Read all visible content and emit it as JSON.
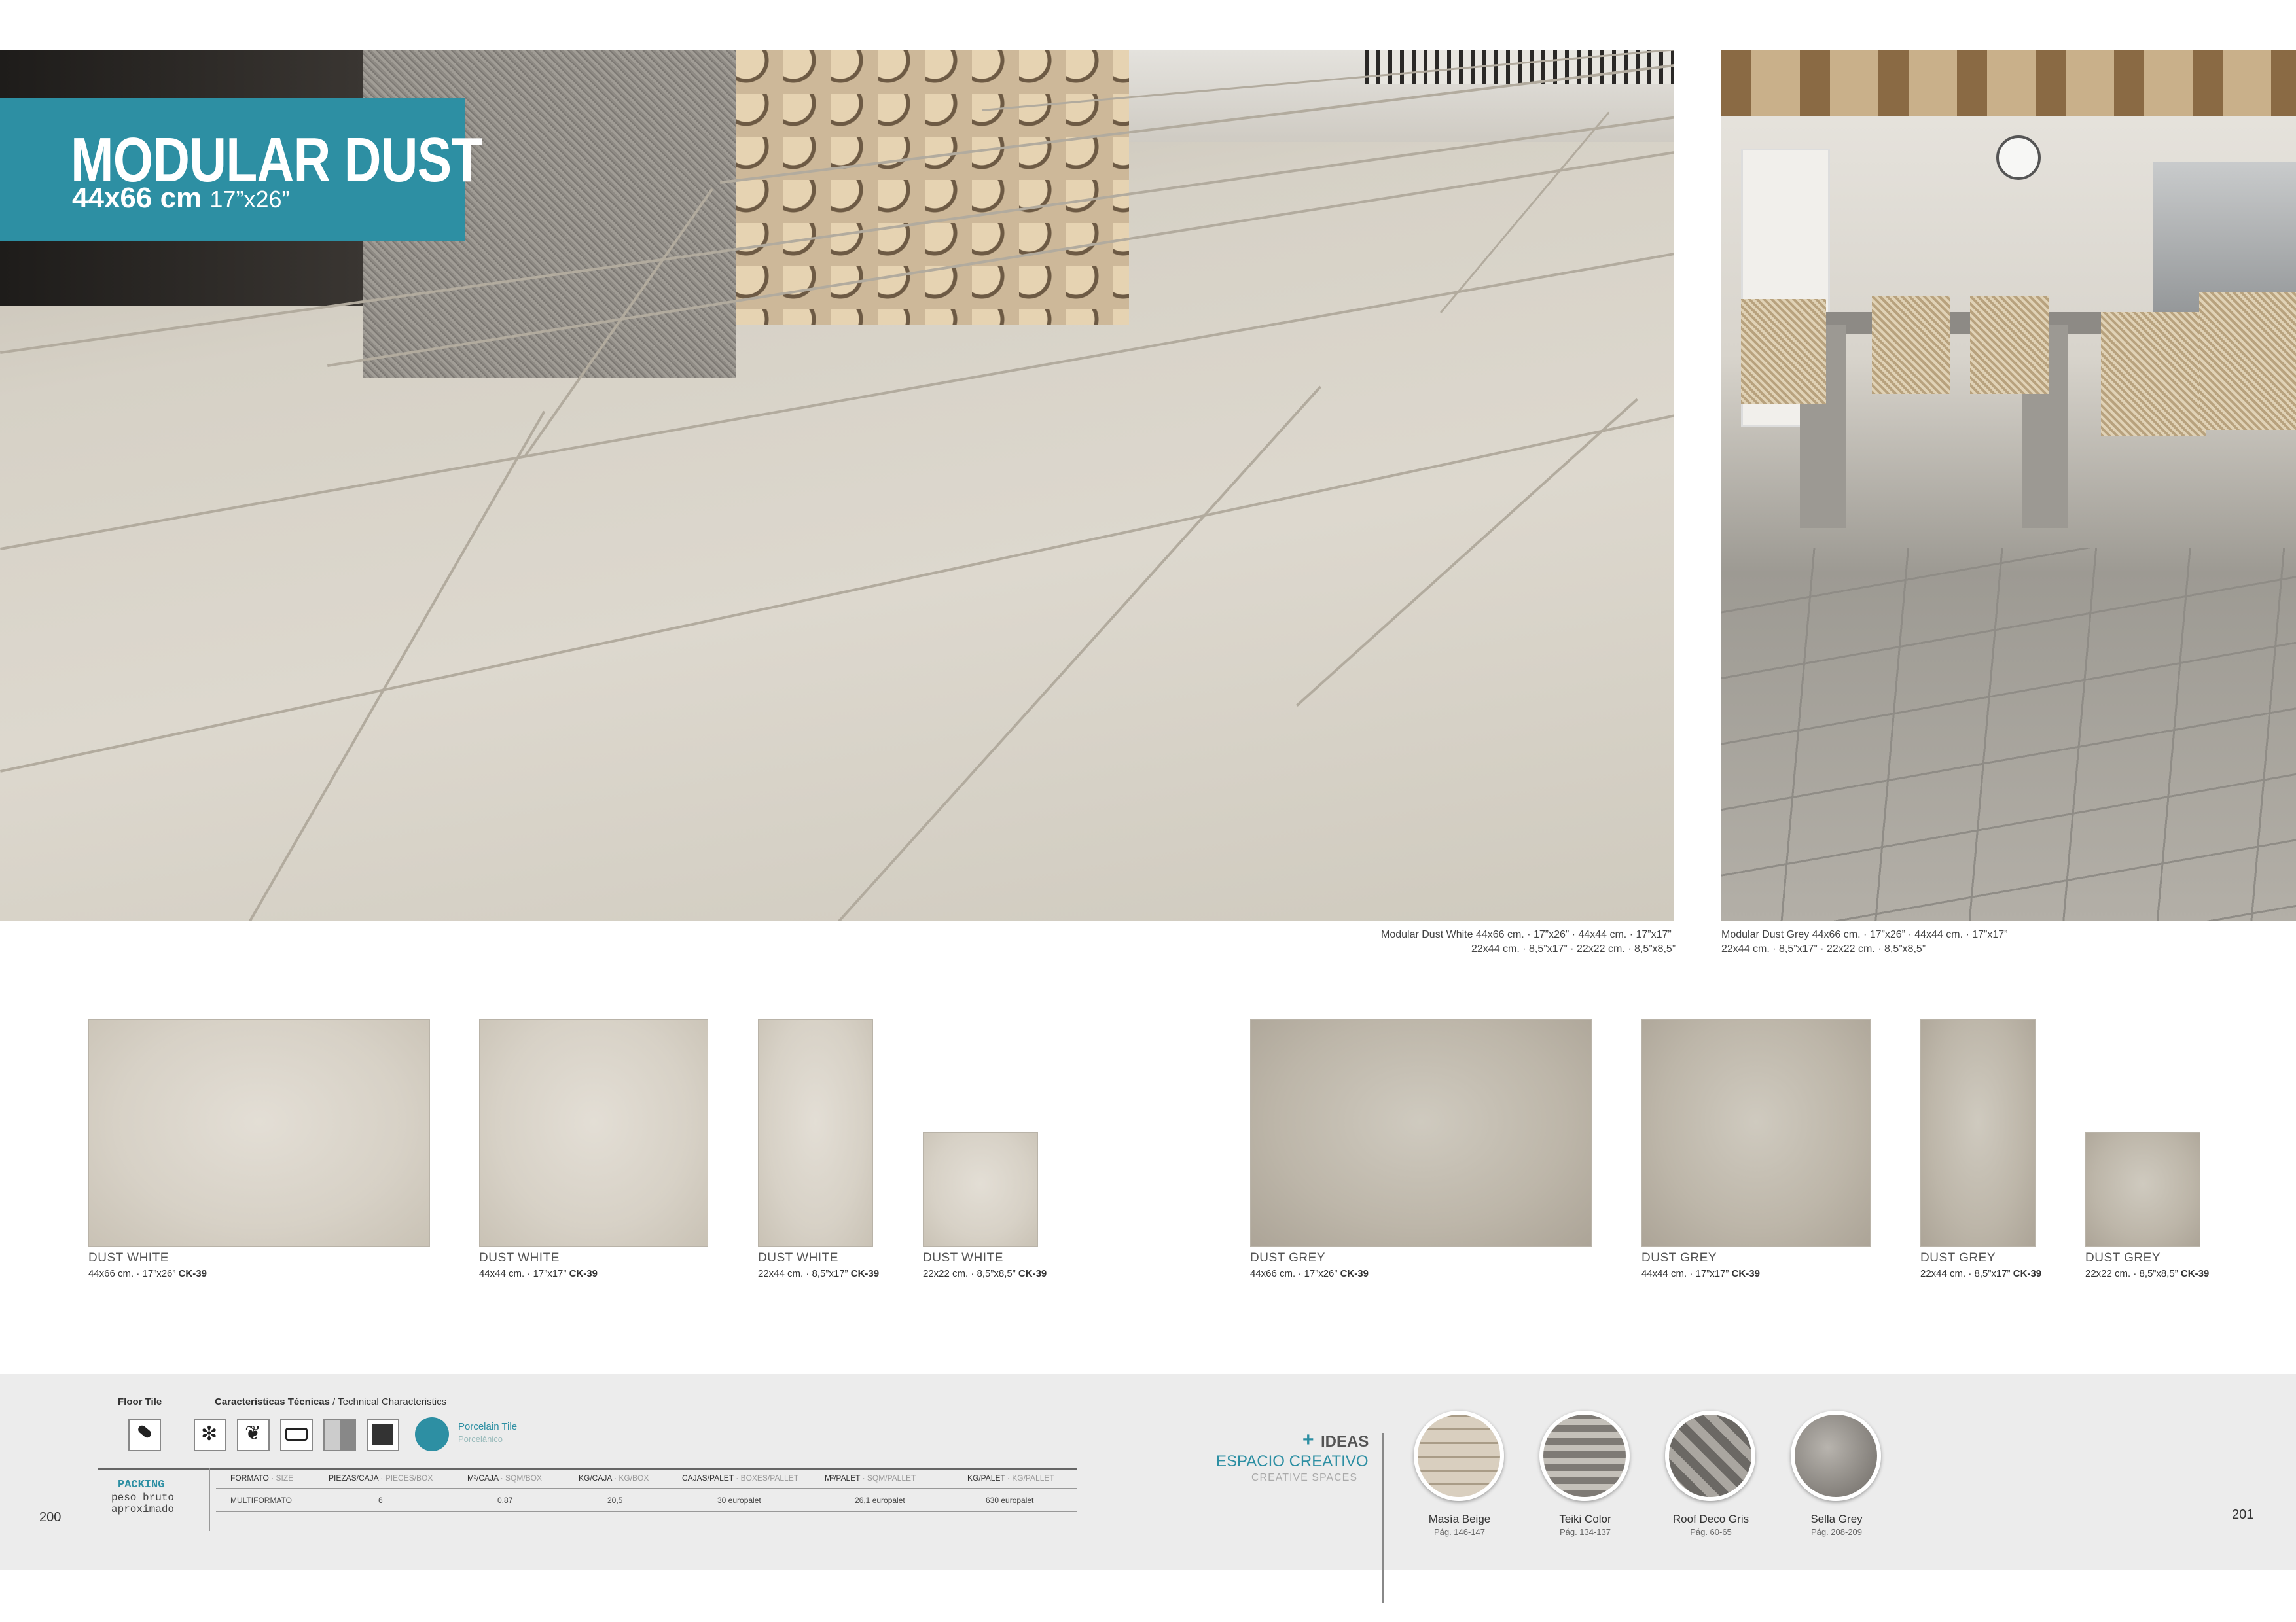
{
  "title": {
    "name": "MODULAR DUST",
    "size_cm": "44x66 cm",
    "size_in": "17”x26”"
  },
  "photos": {
    "main_caption_line1": "Modular Dust White  44x66 cm. · 17”x26” · 44x44 cm. · 17”x17”",
    "main_caption_line2": "22x44 cm. · 8,5”x17” · 22x22 cm. · 8,5”x8,5”",
    "side_caption_line1": "Modular Dust Grey  44x66 cm. · 17”x26” · 44x44 cm. · 17”x17”",
    "side_caption_line2": "22x44 cm. · 8,5”x17” · 22x22 cm. · 8,5”x8,5”"
  },
  "swatches": [
    {
      "name": "DUST WHITE",
      "size": "44x66 cm. · 17”x26”",
      "code": "CK-39"
    },
    {
      "name": "DUST WHITE",
      "size": "44x44 cm. · 17”x17”",
      "code": "CK-39"
    },
    {
      "name": "DUST WHITE",
      "size": "22x44 cm. · 8,5”x17”",
      "code": "CK-39"
    },
    {
      "name": "DUST WHITE",
      "size": "22x22 cm. · 8,5”x8,5”",
      "code": "CK-39"
    },
    {
      "name": "DUST GREY",
      "size": "44x66 cm. · 17”x26”",
      "code": "CK-39"
    },
    {
      "name": "DUST GREY",
      "size": "44x44 cm. · 17”x17”",
      "code": "CK-39"
    },
    {
      "name": "DUST GREY",
      "size": "22x44 cm. · 8,5”x17”",
      "code": "CK-39"
    },
    {
      "name": "DUST GREY",
      "size": "22x22 cm. · 8,5”x8,5”",
      "code": "CK-39"
    }
  ],
  "footer": {
    "floor_tile": "Floor Tile",
    "tech_es": "Características Técnicas",
    "tech_en": " / Technical Characteristics",
    "porcelain_en": "Porcelain Tile",
    "porcelain_es": "Porcelánico",
    "packing": "PACKING",
    "packing_sub1": "peso bruto",
    "packing_sub2": "aproximado",
    "table_headers": [
      {
        "es": "FORMATO",
        "en": " · SIZE"
      },
      {
        "es": "PIEZAS/CAJA",
        "en": " · PIECES/BOX"
      },
      {
        "es": "M²/CAJA",
        "en": " · SQM/BOX"
      },
      {
        "es": "KG/CAJA",
        "en": " · KG/BOX"
      },
      {
        "es": "CAJAS/PALET",
        "en": " · BOXES/PALLET"
      },
      {
        "es": "M²/PALET",
        "en": " · SQM/PALLET"
      },
      {
        "es": "KG/PALET",
        "en": " · KG/PALLET"
      }
    ],
    "table_row": [
      "MULTIFORMATO",
      "6",
      "0,87",
      "20,5",
      "30 europalet",
      "26,1 europalet",
      "630 europalet"
    ],
    "page_left": "200",
    "page_right": "201",
    "ideas_plus": "+",
    "ideas_label": "IDEAS",
    "ideas_es": "ESPACIO CREATIVO",
    "ideas_en": "CREATIVE SPACES",
    "ideas": [
      {
        "name": "Masía Beige",
        "pages": "Pág. 146-147"
      },
      {
        "name": "Teiki Color",
        "pages": "Pág. 134-137"
      },
      {
        "name": "Roof Deco Gris",
        "pages": "Pág. 60-65"
      },
      {
        "name": "Sella Grey",
        "pages": "Pág. 208-209"
      }
    ]
  },
  "colors": {
    "accent": "#2d8fa3",
    "footer_bg": "#ececec"
  }
}
